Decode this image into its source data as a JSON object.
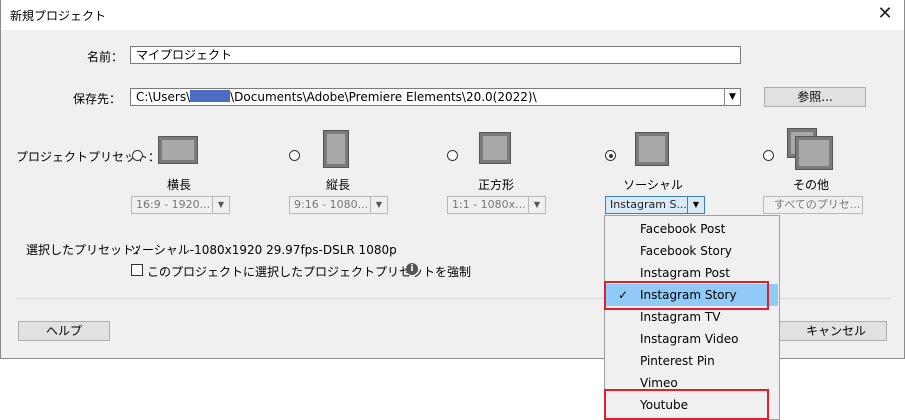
{
  "window": {
    "title": "新規プロジェクト",
    "close_symbol": "✕"
  },
  "form": {
    "name_label": "名前：",
    "name_value": "マイプロジェクト",
    "save_label": "保存先：",
    "save_path_prefix": "C:\\Users\\",
    "save_path_suffix": "\\Documents\\Adobe\\Premiere Elements\\20.0(2022)\\",
    "browse_button": "参照...",
    "preset_label": "プロジェクトプリセット："
  },
  "presets": [
    {
      "name": "横長",
      "combo": "16:9 - 1920...",
      "selected": false,
      "icon": "landscape-image-icon"
    },
    {
      "name": "縦長",
      "combo": "9:16 - 1080...",
      "selected": false,
      "icon": "portrait-image-icon"
    },
    {
      "name": "正方形",
      "combo": "1:1 - 1080x...",
      "selected": false,
      "icon": "square-image-icon"
    },
    {
      "name": "ソーシャル",
      "combo": "Instagram S...",
      "selected": true,
      "icon": "social-image-icon"
    },
    {
      "name": "その他",
      "combo": "すべてのプリセ...",
      "selected": false,
      "icon": "stacked-images-icon"
    }
  ],
  "selected_preset": {
    "label": "選択したプリセット：",
    "value": "ソーシャル-1080x1920 29.97fps-DSLR 1080p"
  },
  "force_checkbox": {
    "label": "このプロジェクトに選択したプロジェクトプリセットを強制",
    "checked": false
  },
  "footer": {
    "help_button": "ヘルプ",
    "cancel_button": "キャンセル"
  },
  "dropdown_menu": {
    "items": [
      "Facebook Post",
      "Facebook Story",
      "Instagram Post",
      "Instagram Story",
      "Instagram TV",
      "Instagram Video",
      "Pinterest Pin",
      "Vimeo",
      "Youtube"
    ],
    "selected": "Instagram Story",
    "check_symbol": "✓"
  },
  "colors": {
    "highlight_box": "#e0202a",
    "selected_item": "#91c9f7",
    "redaction": "#4b6cc0"
  }
}
